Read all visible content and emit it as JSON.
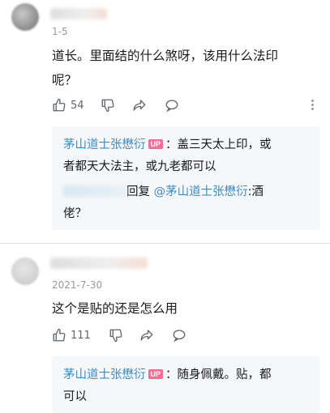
{
  "comments": [
    {
      "date": "1-5",
      "text_line1": "道长。里面结的什么煞呀，该用什么法印",
      "text_line2": "呢？",
      "like_count": "54",
      "replies": [
        {
          "author": "茅山道士张懋衍",
          "badge": "UP",
          "line1": "：盖三天太上印，或",
          "line2": "者都天大法主，或九老都可以"
        },
        {
          "reply_word": "回复",
          "mention": "@茅山道士张懋衍",
          "line1_tail": ":酒",
          "line2": "佬？"
        }
      ]
    },
    {
      "date": "2021-7-30",
      "text_line1": "这个是贴的还是怎么用",
      "like_count": "111",
      "replies": [
        {
          "author": "茅山道士张懋衍",
          "badge": "UP",
          "line1": "：随身佩戴。贴，都",
          "line2": "可以"
        }
      ]
    }
  ],
  "icons": {
    "like": "thumbs-up-icon",
    "dislike": "thumbs-down-icon",
    "share": "share-icon",
    "reply": "comment-bubble-icon",
    "more": "more-vertical-icon"
  },
  "colors": {
    "name_link": "#3c8cc9",
    "up_badge": "#ff6a92",
    "reply_bg": "#f6f7f8",
    "meta_gray": "#9499a0"
  }
}
